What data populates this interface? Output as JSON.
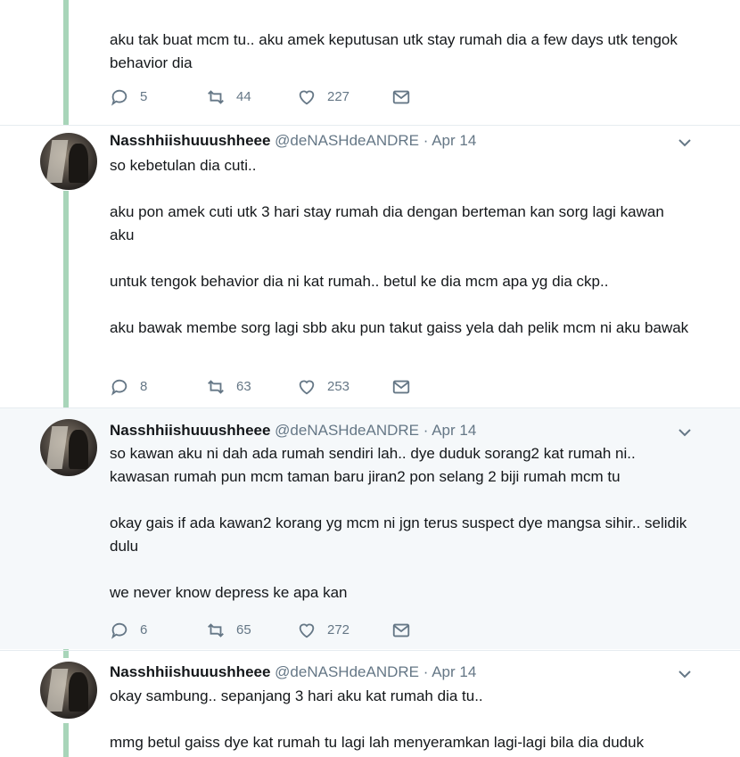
{
  "tweets": [
    {
      "paragraphs": [
        "aku tak buat mcm tu.. aku amek keputusan utk stay rumah dia a few days utk tengok behavior dia"
      ],
      "replies": "5",
      "retweets": "44",
      "likes": "227"
    },
    {
      "name": "Nasshhiishuuushheee",
      "handle": "@deNASHdeANDRE",
      "dot": "·",
      "date": "Apr 14",
      "paragraphs": [
        "so kebetulan dia cuti..",
        "aku pon amek cuti utk 3 hari stay rumah dia dengan berteman kan sorg lagi kawan aku",
        "untuk tengok behavior dia ni kat rumah.. betul ke dia mcm apa yg dia ckp..",
        "aku bawak membe sorg lagi sbb aku pun takut gaiss yela dah pelik mcm ni aku bawak"
      ],
      "replies": "8",
      "retweets": "63",
      "likes": "253"
    },
    {
      "name": "Nasshhiishuuushheee",
      "handle": "@deNASHdeANDRE",
      "dot": "·",
      "date": "Apr 14",
      "paragraphs": [
        "so kawan aku ni dah ada rumah sendiri lah.. dye duduk sorang2 kat rumah ni.. kawasan rumah pun mcm taman baru jiran2 pon selang 2 biji rumah mcm tu",
        "okay gais if ada kawan2 korang yg mcm ni jgn terus suspect dye mangsa sihir.. selidik dulu",
        "we never know depress ke apa kan"
      ],
      "replies": "6",
      "retweets": "65",
      "likes": "272"
    },
    {
      "name": "Nasshhiishuuushheee",
      "handle": "@deNASHdeANDRE",
      "dot": "·",
      "date": "Apr 14",
      "paragraphs": [
        "okay sambung.. sepanjang 3 hari aku kat rumah dia tu..",
        "mmg betul gaiss dye kat rumah tu lagi lah menyeramkan lagi-lagi bila dia duduk"
      ]
    }
  ],
  "colors": {
    "thread_line": "#a8d5b9",
    "highlight_bg": "#f5f8fa",
    "muted": "#657786"
  },
  "icons": [
    "reply-icon",
    "retweet-icon",
    "like-icon",
    "message-icon",
    "chevron-down-icon"
  ]
}
